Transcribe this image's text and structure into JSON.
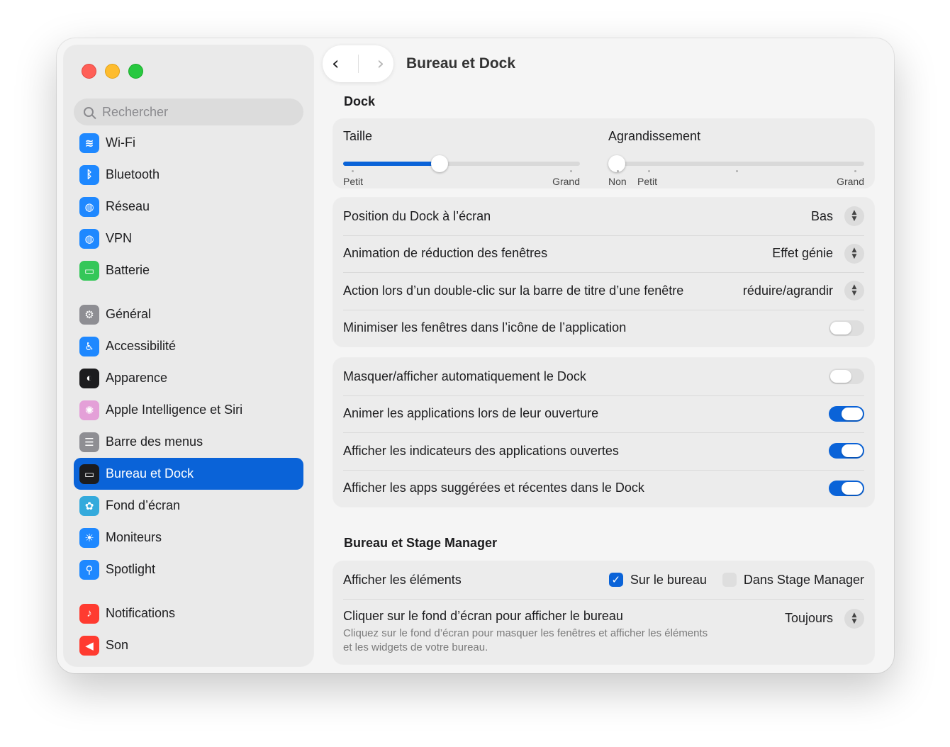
{
  "window": {
    "title": "Bureau et Dock"
  },
  "sidebar": {
    "search_placeholder": "Rechercher",
    "items": [
      {
        "label": "Wi-Fi",
        "icon": "wifi-icon",
        "color": "#1e88ff"
      },
      {
        "label": "Bluetooth",
        "icon": "bluetooth-icon",
        "color": "#1e88ff"
      },
      {
        "label": "Réseau",
        "icon": "globe-icon",
        "color": "#1e88ff"
      },
      {
        "label": "VPN",
        "icon": "vpn-globe-icon",
        "color": "#1e88ff"
      },
      {
        "label": "Batterie",
        "icon": "battery-icon",
        "color": "#34c759"
      },
      {
        "label": "Général",
        "icon": "gear-icon",
        "color": "#8e8e93"
      },
      {
        "label": "Accessibilité",
        "icon": "accessibility-icon",
        "color": "#1e88ff"
      },
      {
        "label": "Apparence",
        "icon": "appearance-icon",
        "color": "#1c1c1e"
      },
      {
        "label": "Apple Intelligence et Siri",
        "icon": "siri-icon",
        "color": "#e4a0d8"
      },
      {
        "label": "Barre des menus",
        "icon": "menubar-icon",
        "color": "#8e8e93"
      },
      {
        "label": "Bureau et Dock",
        "icon": "dock-icon",
        "color": "#1c1c1e",
        "active": true
      },
      {
        "label": "Fond d’écran",
        "icon": "wallpaper-icon",
        "color": "#34aadc"
      },
      {
        "label": "Moniteurs",
        "icon": "sun-icon",
        "color": "#1e88ff"
      },
      {
        "label": "Spotlight",
        "icon": "magnifier-icon",
        "color": "#1e88ff"
      },
      {
        "label": "Notifications",
        "icon": "bell-icon",
        "color": "#ff3b30"
      },
      {
        "label": "Son",
        "icon": "speaker-icon",
        "color": "#ff3b30"
      }
    ]
  },
  "dock": {
    "section_title": "Dock",
    "size": {
      "label": "Taille",
      "min_label": "Petit",
      "max_label": "Grand",
      "value": 0.4
    },
    "magnification": {
      "label": "Agrandissement",
      "off_label": "Non",
      "min_label": "Petit",
      "max_label": "Grand",
      "value": 0
    },
    "settings": [
      {
        "label": "Position du Dock à l’écran",
        "value": "Bas"
      },
      {
        "label": "Animation de réduction des fenêtres",
        "value": "Effet génie"
      },
      {
        "label": "Action lors d’un double-clic sur la barre de titre d’une fenêtre",
        "value": "réduire/agrandir"
      },
      {
        "label": "Minimiser les fenêtres dans l’icône de l’application",
        "toggle": false
      }
    ],
    "toggles": [
      {
        "label": "Masquer/afficher automatiquement le Dock",
        "on": false
      },
      {
        "label": "Animer les applications lors de leur ouverture",
        "on": true
      },
      {
        "label": "Afficher les indicateurs des applications ouvertes",
        "on": true
      },
      {
        "label": "Afficher les apps suggérées et récentes dans le Dock",
        "on": true
      }
    ]
  },
  "stage": {
    "section_title": "Bureau et Stage Manager",
    "show_items": {
      "label": "Afficher les éléments",
      "on_desktop": "Sur le bureau",
      "on_desktop_checked": true,
      "in_stage": "Dans Stage Manager",
      "in_stage_checked": false
    },
    "click_wallpaper": {
      "label": "Cliquer sur le fond d’écran pour afficher le bureau",
      "value": "Toujours",
      "description_line1": "Cliquez sur le fond d’écran pour masquer les fenêtres et afficher les éléments",
      "description_line2": "et les widgets de votre bureau."
    }
  },
  "colors": {
    "accent": "#0a63d8"
  }
}
